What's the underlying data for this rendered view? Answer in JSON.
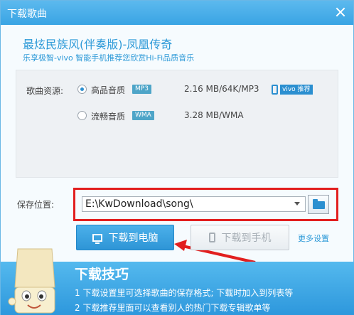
{
  "window": {
    "title": "下载歌曲"
  },
  "song": {
    "title": "最炫民族风(伴奏版)-凤凰传奇",
    "subtitle": "乐享极智-vivo 智能手机推荐您欣赏Hi-Fi品质音乐"
  },
  "source": {
    "label": "歌曲资源:",
    "options": [
      {
        "label": "高品音质",
        "format": "MP3",
        "info": "2.16 MB/64K/MP3",
        "selected": true,
        "promo_badge": "vivo 推荐",
        "promo_icon": "phone-icon"
      },
      {
        "label": "流畅音质",
        "format": "WMA",
        "info": "3.28 MB/WMA",
        "selected": false
      }
    ]
  },
  "save": {
    "label": "保存位置:",
    "path": "E:\\KwDownload\\song\\"
  },
  "buttons": {
    "download_pc": "下载到电脑",
    "download_phone": "下载到手机",
    "more_settings": "更多设置"
  },
  "tips": {
    "title": "下载技巧",
    "lines": [
      "1 下载设置里可选择歌曲的保存格式; 下载时加入到列表等",
      "2 下载推荐里面可以查看别人的热门下载专辑歌单等"
    ]
  },
  "colors": {
    "accent": "#2e9ad8",
    "title_bar": "#3aa4e4",
    "highlight_red": "#e21f1f"
  }
}
